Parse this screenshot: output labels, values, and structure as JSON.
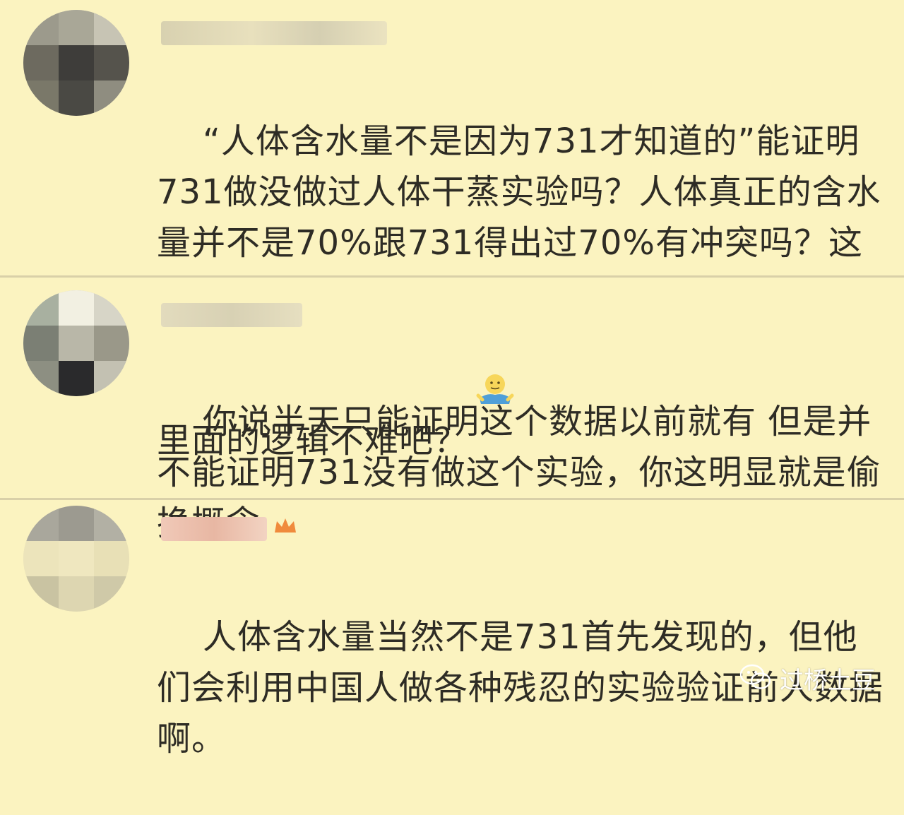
{
  "comments": [
    {
      "text": "“人体含水量不是因为731才知道的”能证明731做没做过人体干蒸实验吗？人体真正的含水量并不是70%跟731得出过70%有冲突吗？这里面的逻辑不难吧？",
      "emoji": "shrug-emoji"
    },
    {
      "text": "你说半天只能证明这个数据以前就有 但是并不能证明731没有做这个实验，你这明显就是偷换概念"
    },
    {
      "text": "人体含水量当然不是731首先发现的，但他们会利用中国人做各种残忍的实验验证前人数据啊。"
    }
  ],
  "watermark": {
    "text": "过桥土豆",
    "icon": "wechat-icon"
  },
  "colors": {
    "background": "#fbf3c0",
    "text": "#2e2c25",
    "divider": "#d9d0a8"
  }
}
